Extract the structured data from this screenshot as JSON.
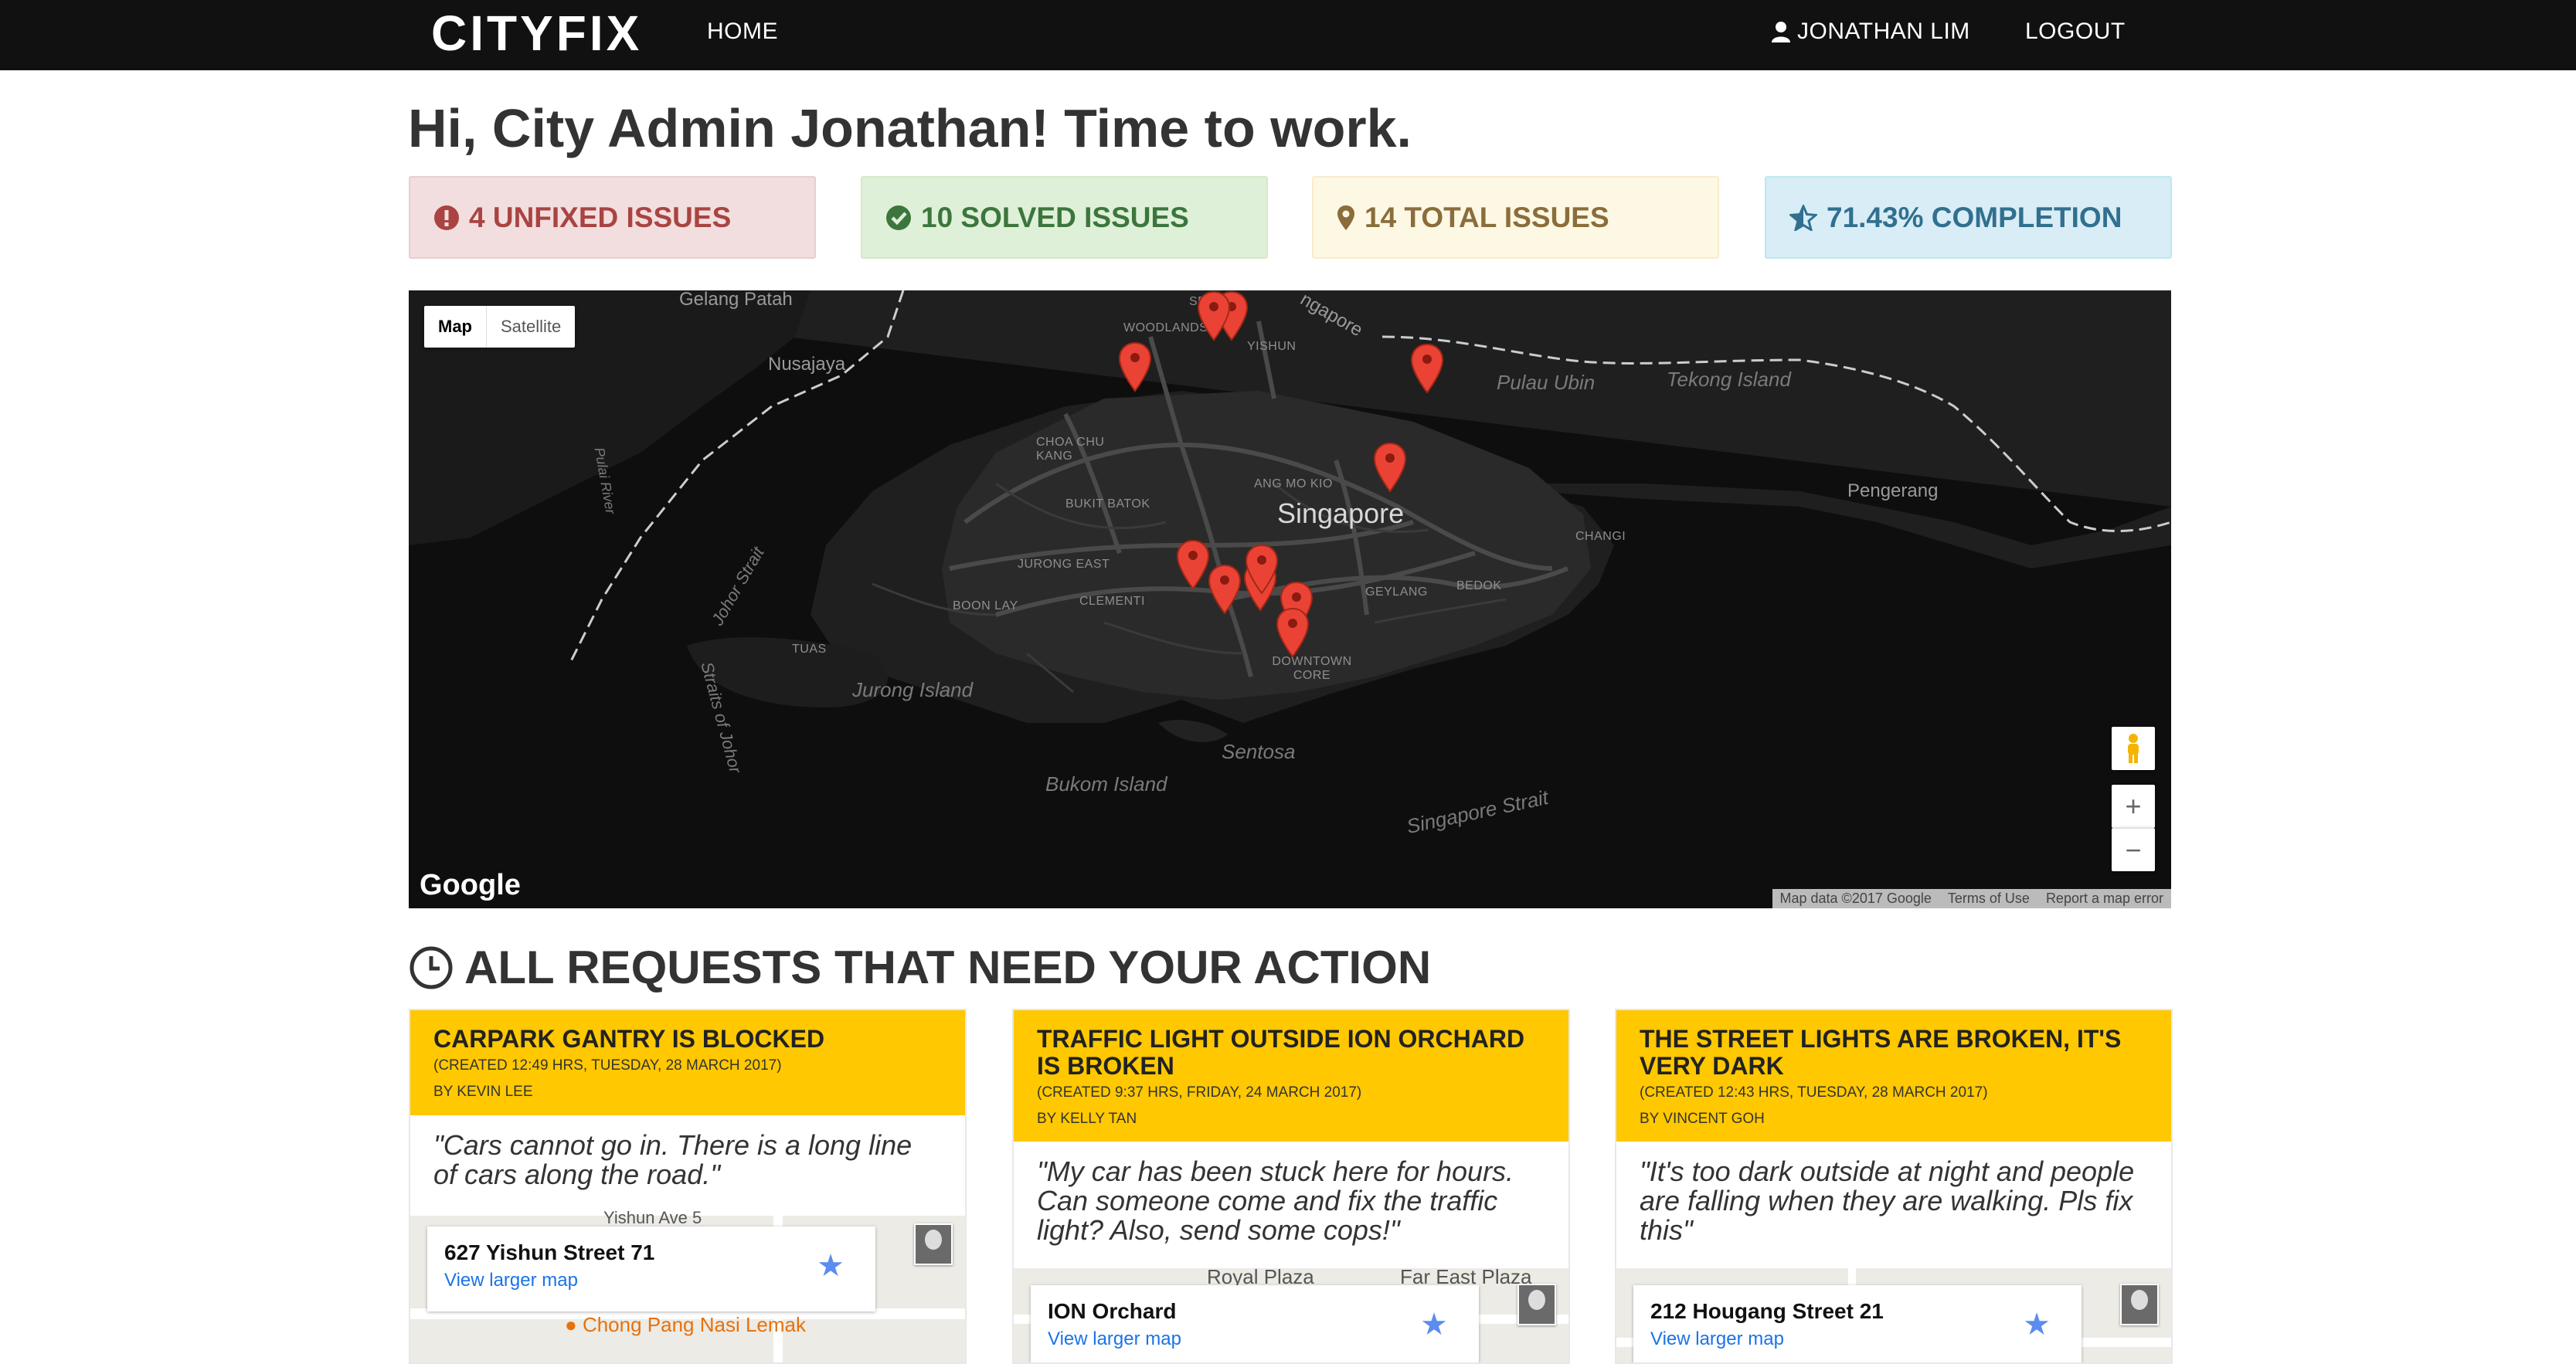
{
  "nav": {
    "brand": "CITYFIX",
    "home": "HOME",
    "user": "JONATHAN LIM",
    "logout": "LOGOUT"
  },
  "greeting": "Hi, City Admin Jonathan! Time to work.",
  "stats": {
    "unfixed": "4 UNFIXED ISSUES",
    "solved": "10 SOLVED ISSUES",
    "total": "14 TOTAL ISSUES",
    "completion": "71.43% COMPLETION"
  },
  "map": {
    "type_map": "Map",
    "type_satellite": "Satellite",
    "labels": {
      "gelang_patah": "Gelang Patah",
      "nusajaya": "Nusajaya",
      "sembawang": "SEMBA",
      "yishun": "YISHUN",
      "woodlands": "WOODLANDS",
      "singapore_river": "ngapore",
      "pulau_ubin": "Pulau Ubin",
      "tekong": "Tekong Island",
      "choa_chu_kang": "CHOA CHU KANG",
      "ang_mo_kio": "ANG MO KIO",
      "singapore": "Singapore",
      "bukit_batok": "BUKIT BATOK",
      "changi": "CHANGI",
      "pengerang": "Pengerang",
      "jurong_east": "JURONG EAST",
      "boon_lay": "BOON LAY",
      "clementi": "CLEMENTI",
      "geylang": "GEYLANG",
      "bedok": "BEDOK",
      "tuas": "TUAS",
      "downtown_core": "DOWNTOWN CORE",
      "jurong_island": "Jurong Island",
      "sentosa": "Sentosa",
      "bukom": "Bukom Island",
      "singapore_strait": "Singapore Strait",
      "johor_strait": "Johor Strait",
      "straits_of_johor": "Straits of Johor",
      "pulai_river": "Pulai River"
    },
    "google": "Google",
    "attribution": [
      "Map data ©2017 Google",
      "Terms of Use",
      "Report a map error"
    ]
  },
  "section_title": "ALL REQUESTS THAT NEED YOUR ACTION",
  "requests": [
    {
      "title": "CARPARK GANTRY IS BLOCKED",
      "created": "(CREATED 12:49 HRS, TUESDAY, 28 MARCH 2017)",
      "by": "BY KEVIN LEE",
      "quote": "\"Cars cannot go in. There is a long line of cars along the road.\"",
      "location": "627 Yishun Street 71",
      "link": "View larger map",
      "map_street": "Yishun Ave 5",
      "map_poi": "Chong Pang Nasi Lemak"
    },
    {
      "title": "TRAFFIC LIGHT OUTSIDE ION ORCHARD IS BROKEN",
      "created": "(CREATED 9:37 HRS, FRIDAY, 24 MARCH 2017)",
      "by": "BY KELLY TAN",
      "quote": "\"My car has been stuck here for hours. Can someone come and fix the traffic light? Also, send some cops!\"",
      "location": "ION Orchard",
      "link": "View larger map",
      "map_poi1": "Royal Plaza",
      "map_poi2": "Far East Plaza"
    },
    {
      "title": "THE STREET LIGHTS ARE BROKEN, IT'S VERY DARK",
      "created": "(CREATED 12:43 HRS, TUESDAY, 28 MARCH 2017)",
      "by": "BY VINCENT GOH",
      "quote": "\"It's too dark outside at night and people are falling when they are walking. Pls fix this\"",
      "location": "212 Hougang Street 21",
      "link": "View larger map"
    }
  ]
}
